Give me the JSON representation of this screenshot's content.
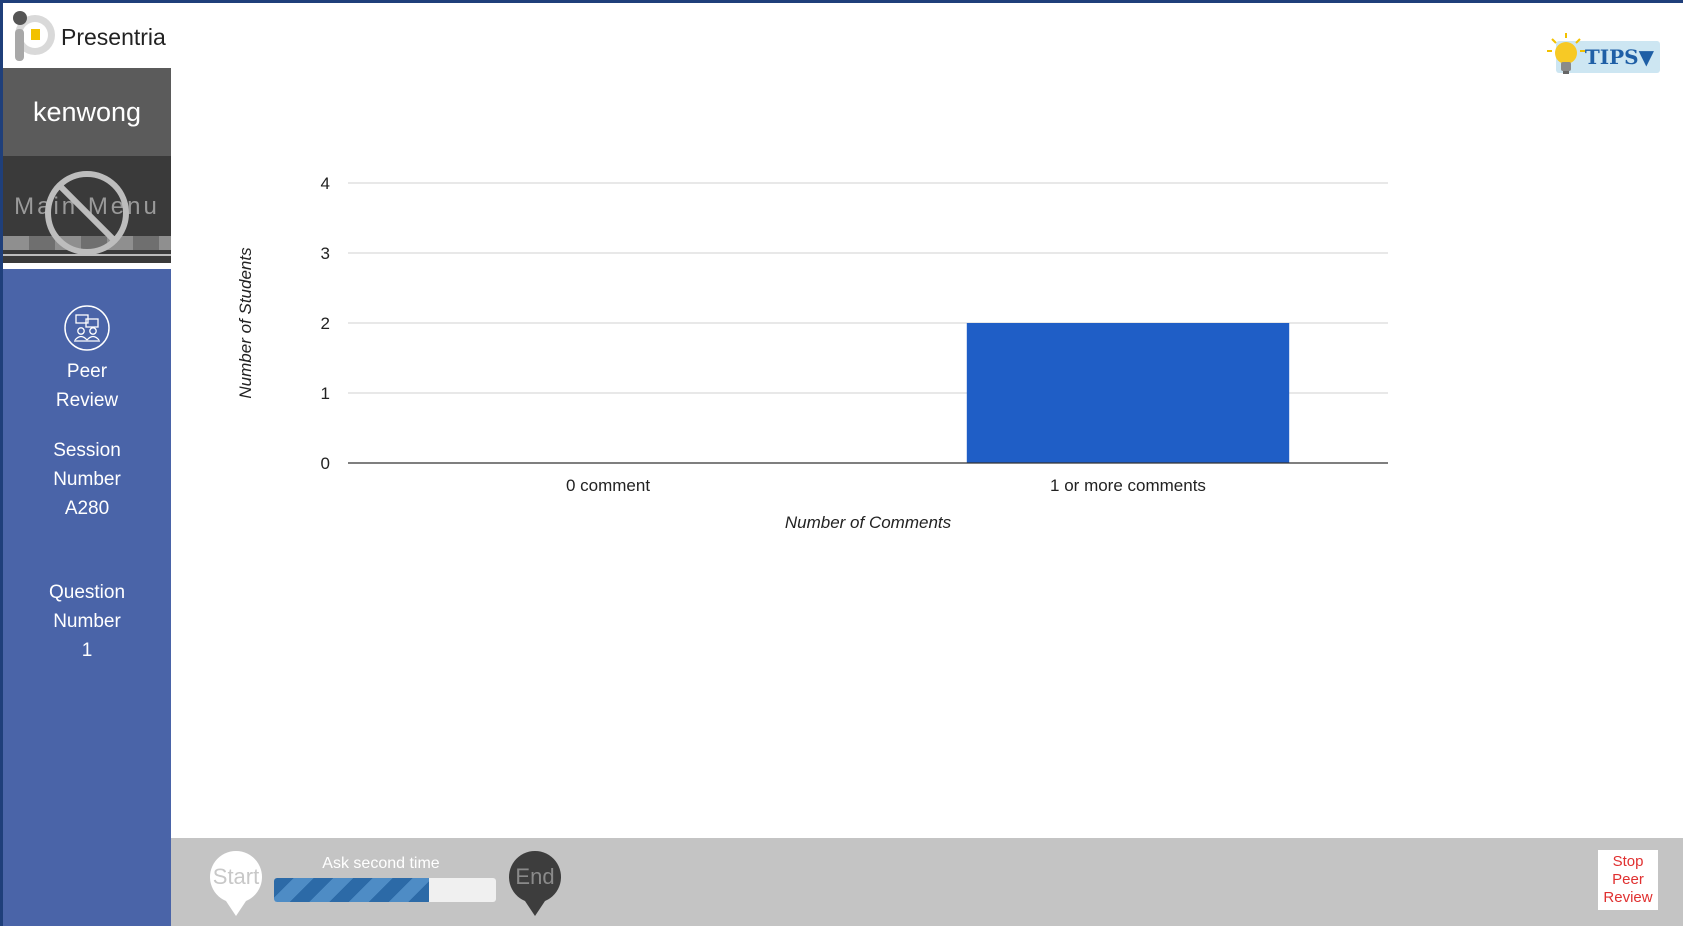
{
  "app": {
    "title": "Presentria"
  },
  "sidebar": {
    "username": "kenwong",
    "main_menu": "Main Menu",
    "peer_review": [
      "Peer",
      "Review"
    ],
    "session": [
      "Session",
      "Number",
      "A280"
    ],
    "question": [
      "Question",
      "Number",
      "1"
    ]
  },
  "tips": {
    "label": "TIPS▼"
  },
  "chart_data": {
    "type": "bar",
    "categories": [
      "0 comment",
      "1 or more comments"
    ],
    "values": [
      0,
      2
    ],
    "xlabel": "Number of Comments",
    "ylabel": "Number of Students",
    "ylim": [
      0,
      4
    ],
    "yticks": [
      0,
      1,
      2,
      3,
      4
    ],
    "grid": true,
    "bar_color": "#1f5ec6"
  },
  "bottombar": {
    "start_label": "Start",
    "end_label": "End",
    "progress_label": "Ask second time",
    "progress_fraction": 0.7,
    "stop_lines": [
      "Stop",
      "Peer",
      "Review"
    ]
  },
  "colors": {
    "sidebar": "#4a64a8",
    "accent": "#1f5ec6",
    "stop": "#e03030"
  },
  "icons": [
    "presentria-logo-icon",
    "blocked-icon",
    "peer-review-icon",
    "lightbulb-icon",
    "start-pin-icon",
    "end-pin-icon"
  ]
}
